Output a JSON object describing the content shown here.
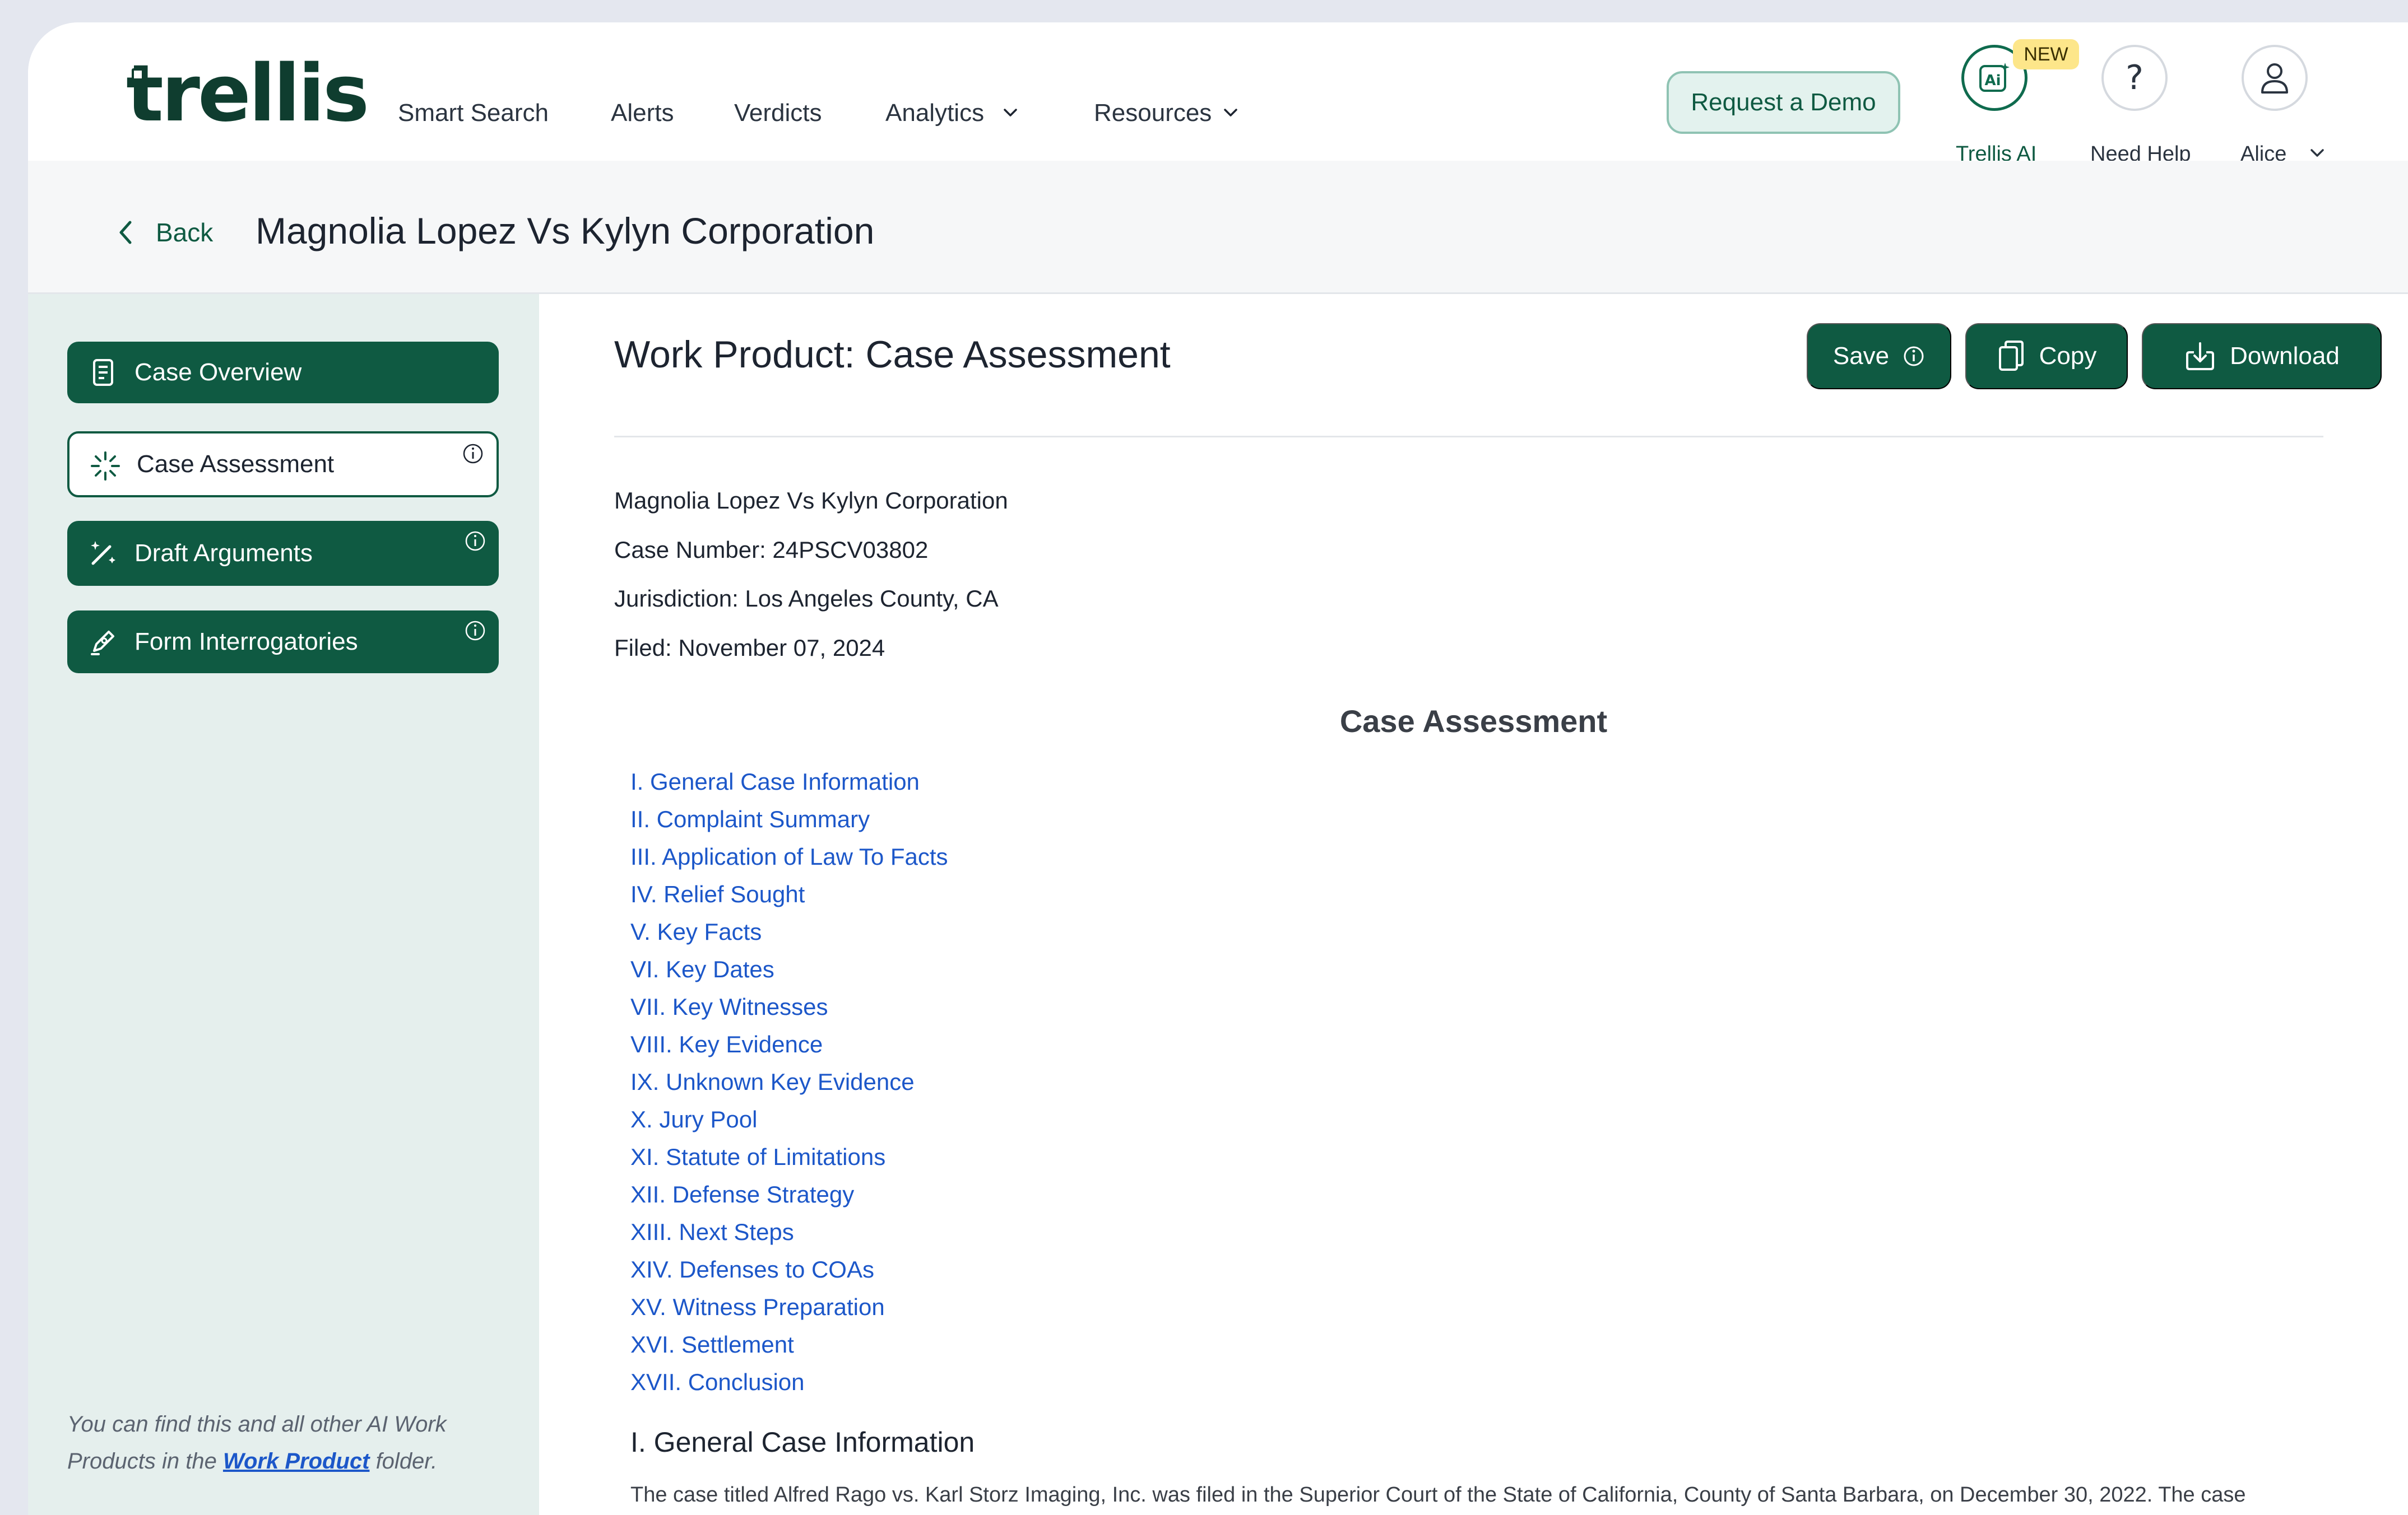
{
  "header": {
    "logo": "trellis",
    "nav": [
      {
        "label": "Smart Search"
      },
      {
        "label": "Alerts"
      },
      {
        "label": "Verdicts"
      },
      {
        "label": "Analytics"
      },
      {
        "label": "Resources"
      }
    ],
    "request_demo": "Request a Demo",
    "new_badge": "NEW",
    "trellis_ai": "Trellis AI",
    "need_help": "Need Help",
    "user": "Alice"
  },
  "titlebar": {
    "back": "Back",
    "case_title": "Magnolia Lopez Vs Kylyn Corporation"
  },
  "sidebar": {
    "items": [
      {
        "label": "Case Overview",
        "active": false
      },
      {
        "label": "Case Assessment",
        "active": true
      },
      {
        "label": "Draft Arguments",
        "active": false
      },
      {
        "label": "Form Interrogatories",
        "active": false
      }
    ],
    "note_pre": "You can find this and all other AI Work Products in the ",
    "note_link": "Work Product",
    "note_post": " folder."
  },
  "main": {
    "title": "Work Product: Case Assessment",
    "save": "Save",
    "copy": "Copy",
    "download": "Download",
    "meta": {
      "case_name": "Magnolia Lopez Vs Kylyn Corporation",
      "case_number": "Case Number: 24PSCV03802",
      "jurisdiction": "Jurisdiction: Los Angeles County, CA",
      "filed": "Filed: November 07, 2024"
    },
    "section_heading": "Case Assessment",
    "toc": [
      "I. General Case Information",
      "II. Complaint Summary",
      "III. Application of Law To Facts",
      "IV. Relief Sought",
      "V. Key Facts",
      "VI. Key Dates",
      "VII. Key Witnesses",
      "VIII. Key Evidence",
      "IX. Unknown Key Evidence",
      "X. Jury Pool",
      "XI. Statute of Limitations",
      "XII. Defense Strategy",
      "XIII. Next Steps",
      "XIV. Defenses to COAs",
      "XV. Witness Preparation",
      "XVI. Settlement",
      "XVII. Conclusion"
    ],
    "gci_heading": "I. General Case Information",
    "gci_text": "The case titled Alfred Rago vs. Karl Storz Imaging, Inc. was filed in the Superior Court of the State of California, County of Santa Barbara, on December 30, 2022. The case bears the number 22CV05146. Alfred Rago, the plaintiff, is represented by attorneys Ann Hendrix and Morgan I. Good from The Myers Law Group, A.P.C. The defendant in this case is"
  },
  "colors": {
    "brand": "#0f5a42",
    "link": "#1c57c9",
    "sidebar_bg": "#e5efed",
    "badge": "#fde68a"
  },
  "icons": [
    "trellis-ai-icon",
    "question-icon",
    "user-icon",
    "chevron-down-icon",
    "chevron-left-icon",
    "scroll-icon",
    "sparkle-icon",
    "wand-icon",
    "pen-icon",
    "info-icon",
    "copy-icon",
    "download-icon"
  ]
}
